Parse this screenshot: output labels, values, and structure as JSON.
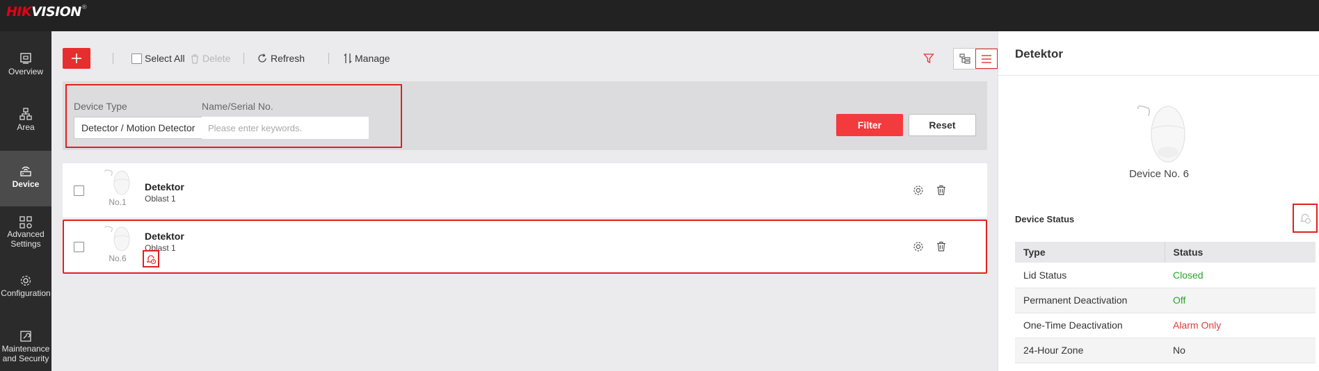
{
  "brand": {
    "hik": "HIK",
    "vision": "VISION",
    "reg": "®"
  },
  "nav": [
    {
      "label": "Overview",
      "icon": "overview-icon"
    },
    {
      "label": "Area",
      "icon": "area-icon"
    },
    {
      "label": "Device",
      "icon": "device-icon",
      "active": true
    },
    {
      "label_line1": "Advanced",
      "label_line2": "Settings",
      "icon": "advanced-settings-icon"
    },
    {
      "label": "Configuration",
      "icon": "gear-icon"
    },
    {
      "label_line1": "Maintenance",
      "label_line2": "and Security",
      "icon": "maintenance-icon"
    }
  ],
  "toolbar": {
    "select_all": "Select All",
    "delete": "Delete",
    "refresh": "Refresh",
    "manage": "Manage"
  },
  "filter": {
    "device_type_label": "Device Type",
    "device_type_value": "Detector / Motion Detector",
    "name_label": "Name/Serial No.",
    "name_placeholder": "Please enter keywords.",
    "filter_button": "Filter",
    "reset_button": "Reset"
  },
  "devices": [
    {
      "name": "Detektor",
      "area": "Oblast 1",
      "number": "No.1"
    },
    {
      "name": "Detektor",
      "area": "Oblast 1",
      "number": "No.6"
    }
  ],
  "detail": {
    "title": "Detektor",
    "device_no": "Device No. 6",
    "status_title": "Device Status",
    "table_headers": {
      "type": "Type",
      "status": "Status"
    },
    "rows": [
      {
        "type": "Lid Status",
        "status": "Closed",
        "color": "#2aa52a"
      },
      {
        "type": "Permanent Deactivation",
        "status": "Off",
        "color": "#2aa52a"
      },
      {
        "type": "One-Time Deactivation",
        "status": "Alarm Only",
        "color": "#e43a3a"
      },
      {
        "type": "24-Hour Zone",
        "status": "No",
        "color": "#333333"
      }
    ]
  },
  "colors": {
    "accent": "#e72e2e",
    "nav_bg": "#2b2b2b",
    "topbar": "#222222"
  }
}
